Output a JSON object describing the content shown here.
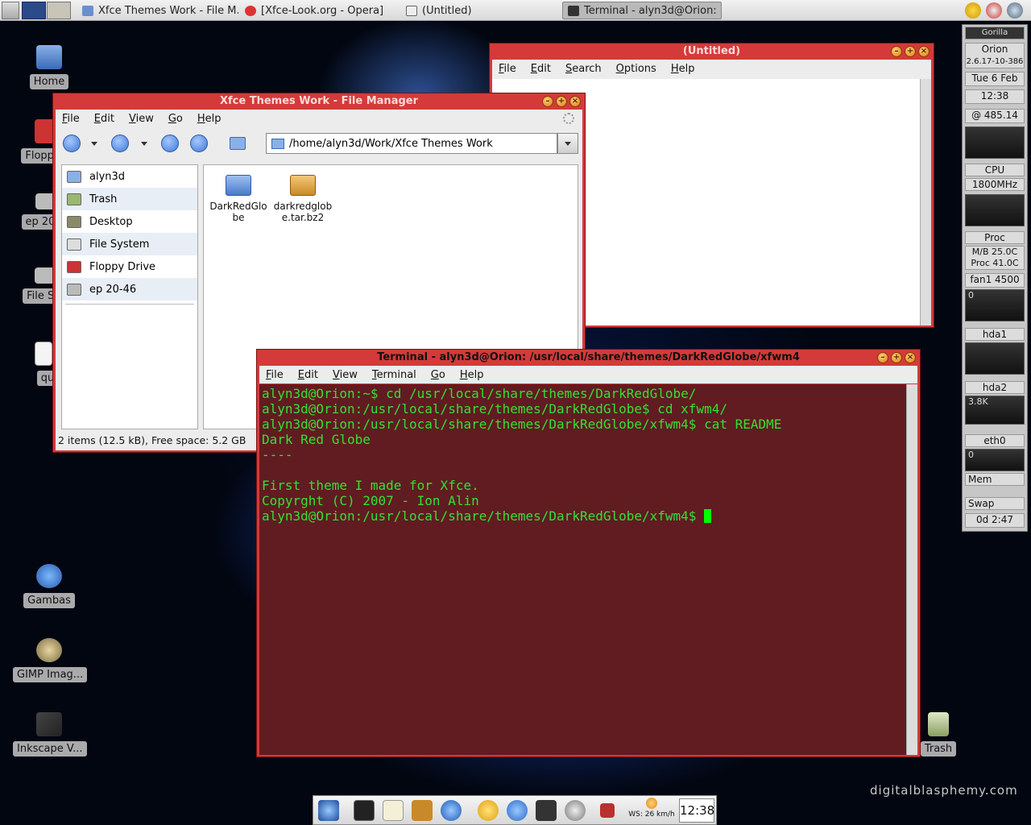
{
  "top_panel": {
    "tasks": [
      {
        "label": "Xfce Themes Work - File M...",
        "active": false
      },
      {
        "label": "[Xfce-Look.org - Opera]",
        "active": false
      },
      {
        "label": "(Untitled)",
        "active": false
      },
      {
        "label": "Terminal - alyn3d@Orion: ...",
        "active": true
      }
    ]
  },
  "desktop_icons": [
    {
      "label": "Home",
      "icon": "home-folder-icon"
    },
    {
      "label": "Floppy",
      "icon": "floppy-icon"
    },
    {
      "label": "ep 20",
      "icon": "drive-icon"
    },
    {
      "label": "File Sy",
      "icon": "drive-icon"
    },
    {
      "label": "qua",
      "icon": "document-icon"
    },
    {
      "label": "Gambas",
      "icon": "gambas-icon"
    },
    {
      "label": "GIMP Imag...",
      "icon": "gimp-icon"
    },
    {
      "label": "Inkscape V...",
      "icon": "inkscape-icon"
    },
    {
      "label": "Trash",
      "icon": "trash-icon"
    }
  ],
  "watermark": "digitalblasphemy.com",
  "editor": {
    "title": "(Untitled)",
    "menu": [
      "File",
      "Edit",
      "Search",
      "Options",
      "Help"
    ]
  },
  "file_manager": {
    "title": "Xfce Themes Work - File Manager",
    "menu": [
      "File",
      "Edit",
      "View",
      "Go",
      "Help"
    ],
    "path": "/home/alyn3d/Work/Xfce Themes Work",
    "sidebar": [
      "alyn3d",
      "Trash",
      "Desktop",
      "File System",
      "Floppy Drive",
      "ep 20-46"
    ],
    "files": [
      {
        "name": "DarkRedGlobe",
        "icon": "folder-icon"
      },
      {
        "name": "darkredglobe.tar.bz2",
        "icon": "archive-icon"
      }
    ],
    "status": "2 items (12.5 kB), Free space: 5.2 GB"
  },
  "terminal": {
    "title": "Terminal - alyn3d@Orion: /usr/local/share/themes/DarkRedGlobe/xfwm4",
    "menu": [
      "File",
      "Edit",
      "View",
      "Terminal",
      "Go",
      "Help"
    ],
    "lines": [
      "alyn3d@Orion:~$ cd /usr/local/share/themes/DarkRedGlobe/",
      "alyn3d@Orion:/usr/local/share/themes/DarkRedGlobe$ cd xfwm4/",
      "alyn3d@Orion:/usr/local/share/themes/DarkRedGlobe/xfwm4$ cat README",
      "Dark Red Globe",
      "----",
      "",
      "First theme I made for Xfce.",
      "Copyrght (C) 2007 - Ion Alin"
    ],
    "prompt": "alyn3d@Orion:/usr/local/share/themes/DarkRedGlobe/xfwm4$ "
  },
  "gkrellm": {
    "brand": "Gorilla",
    "host": "Orion",
    "kernel": "2.6.17-10-386",
    "date": "Tue  6 Feb",
    "time": "12:38",
    "bogomips": "@ 485.14",
    "cpu_label": "CPU",
    "cpu_freq": "1800MHz",
    "proc_label": "Proc",
    "mb_temp_label": "M/B",
    "mb_temp": "25.0C",
    "proc_temp_label": "Proc",
    "proc_temp": "41.0C",
    "fan_label": "fan1",
    "fan_value": "4500",
    "proc_count": "0",
    "hda1_label": "hda1",
    "hda2_label": "hda2",
    "hda2_value": "3.8K",
    "eth0_label": "eth0",
    "eth0_value": "0",
    "mem_label": "Mem",
    "swap_label": "Swap",
    "uptime": "0d  2:47"
  },
  "dock": {
    "weather": "WS: 26 km/h",
    "clock": "12:38"
  }
}
